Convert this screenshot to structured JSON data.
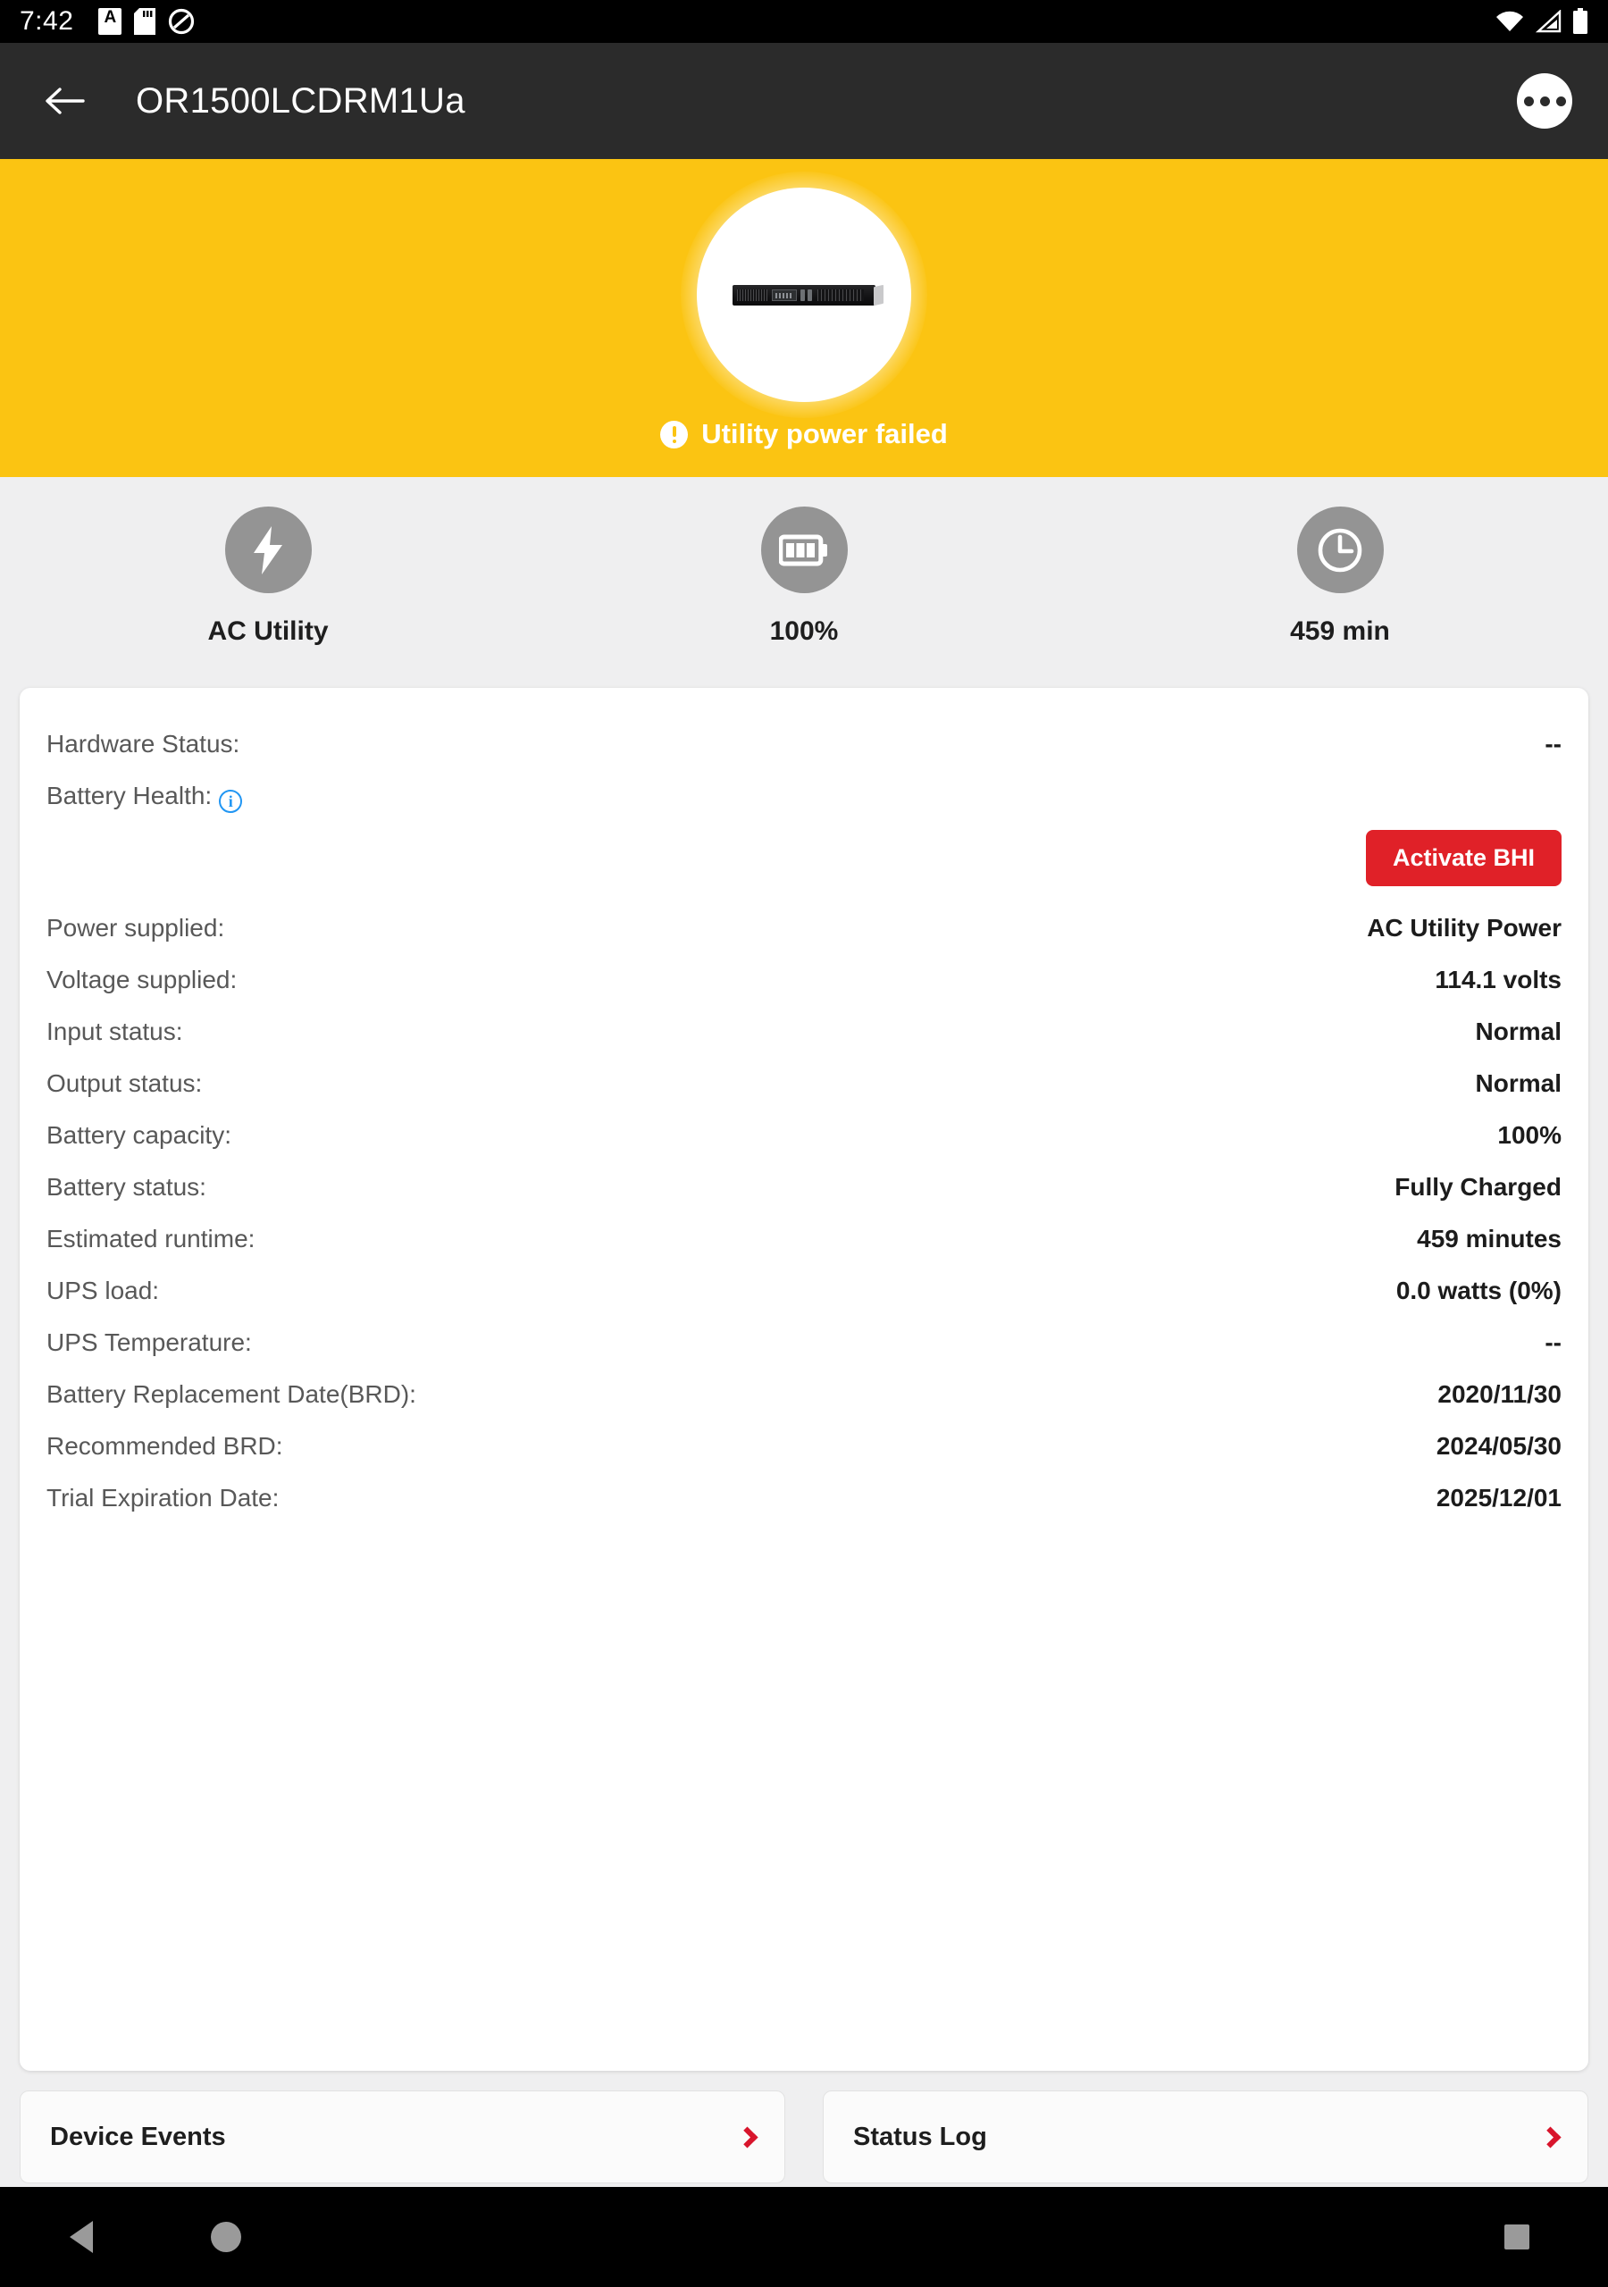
{
  "status_bar": {
    "time": "7:42",
    "left_icons": [
      "a-notification-icon",
      "sd-card-icon",
      "do-not-disturb-icon"
    ],
    "right_icons": [
      "wifi-icon",
      "cellular-signal-icon",
      "battery-icon"
    ]
  },
  "app_bar": {
    "back_label": "Back",
    "title": "OR1500LCDRM1Ua",
    "overflow_label": "More options"
  },
  "hero": {
    "status_text": "Utility power failed",
    "banner_color": "#fbc412",
    "device_image_alt": "OR1500LCDRM1Ua rackmount UPS"
  },
  "stats": [
    {
      "icon": "lightning-bolt-icon",
      "label": "AC Utility"
    },
    {
      "icon": "battery-full-icon",
      "label": "100%"
    },
    {
      "icon": "clock-icon",
      "label": "459 min"
    }
  ],
  "details": {
    "hardware_status": {
      "key": "Hardware Status:",
      "value": "--"
    },
    "battery_health": {
      "key": "Battery Health:",
      "info_glyph": "i"
    },
    "activate_bhi_label": "Activate BHI",
    "activate_bhi_color": "#e02128",
    "rows": [
      {
        "key": "Power supplied:",
        "value": "AC Utility Power"
      },
      {
        "key": "Voltage supplied:",
        "value": "114.1 volts"
      },
      {
        "key": "Input status:",
        "value": "Normal"
      },
      {
        "key": "Output status:",
        "value": "Normal"
      },
      {
        "key": "Battery capacity:",
        "value": "100%"
      },
      {
        "key": "Battery status:",
        "value": "Fully Charged"
      },
      {
        "key": "Estimated runtime:",
        "value": "459 minutes"
      },
      {
        "key": "UPS load:",
        "value": "0.0 watts (0%)"
      },
      {
        "key": "UPS Temperature:",
        "value": "--"
      },
      {
        "key": "Battery Replacement Date(BRD):",
        "value": "2020/11/30"
      },
      {
        "key": "Recommended BRD:",
        "value": "2024/05/30"
      },
      {
        "key": "Trial Expiration Date:",
        "value": "2025/12/01"
      }
    ]
  },
  "bottom_buttons": [
    {
      "label": "Device Events",
      "chevron": "chevron-right-icon"
    },
    {
      "label": "Status Log",
      "chevron": "chevron-right-icon"
    }
  ],
  "system_nav": {
    "back": "back-triangle-icon",
    "home": "home-circle-icon",
    "recents": "recents-square-icon"
  }
}
